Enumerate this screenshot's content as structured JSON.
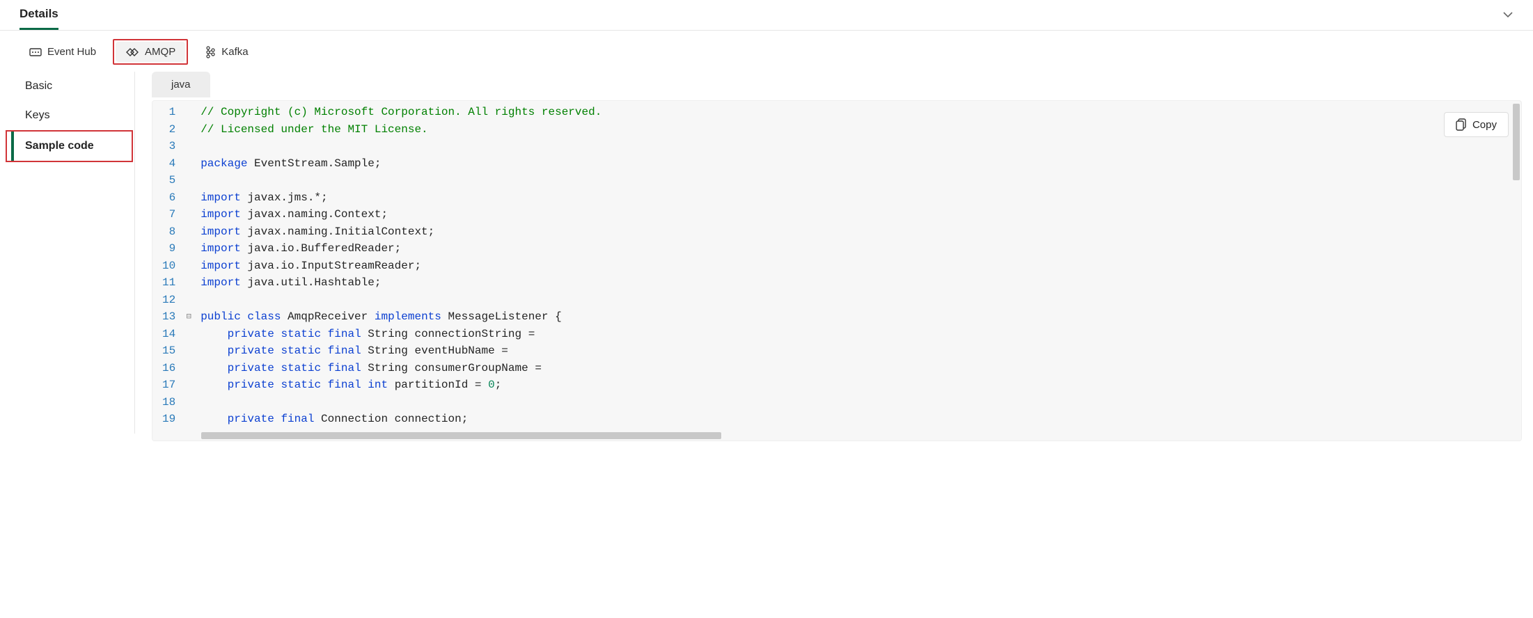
{
  "header": {
    "title": "Details"
  },
  "protoTabs": {
    "items": [
      {
        "label": "Event Hub"
      },
      {
        "label": "AMQP"
      },
      {
        "label": "Kafka"
      }
    ],
    "selectedIndex": 1
  },
  "sidebar": {
    "items": [
      {
        "label": "Basic"
      },
      {
        "label": "Keys"
      },
      {
        "label": "Sample code"
      }
    ],
    "activeIndex": 2
  },
  "langTab": {
    "label": "java"
  },
  "copy": {
    "label": "Copy"
  },
  "code": {
    "lines": [
      [
        {
          "cls": "tok-comment",
          "t": "// Copyright (c) Microsoft Corporation. All rights reserved."
        }
      ],
      [
        {
          "cls": "tok-comment",
          "t": "// Licensed under the MIT License."
        }
      ],
      [
        {
          "cls": "tok-plain",
          "t": ""
        }
      ],
      [
        {
          "cls": "tok-keyword",
          "t": "package"
        },
        {
          "cls": "tok-plain",
          "t": " EventStream.Sample;"
        }
      ],
      [
        {
          "cls": "tok-plain",
          "t": ""
        }
      ],
      [
        {
          "cls": "tok-keyword",
          "t": "import"
        },
        {
          "cls": "tok-plain",
          "t": " javax.jms.*;"
        }
      ],
      [
        {
          "cls": "tok-keyword",
          "t": "import"
        },
        {
          "cls": "tok-plain",
          "t": " javax.naming.Context;"
        }
      ],
      [
        {
          "cls": "tok-keyword",
          "t": "import"
        },
        {
          "cls": "tok-plain",
          "t": " javax.naming.InitialContext;"
        }
      ],
      [
        {
          "cls": "tok-keyword",
          "t": "import"
        },
        {
          "cls": "tok-plain",
          "t": " java.io.BufferedReader;"
        }
      ],
      [
        {
          "cls": "tok-keyword",
          "t": "import"
        },
        {
          "cls": "tok-plain",
          "t": " java.io.InputStreamReader;"
        }
      ],
      [
        {
          "cls": "tok-keyword",
          "t": "import"
        },
        {
          "cls": "tok-plain",
          "t": " java.util.Hashtable;"
        }
      ],
      [
        {
          "cls": "tok-plain",
          "t": ""
        }
      ],
      [
        {
          "cls": "tok-keyword",
          "t": "public"
        },
        {
          "cls": "tok-plain",
          "t": " "
        },
        {
          "cls": "tok-keyword",
          "t": "class"
        },
        {
          "cls": "tok-plain",
          "t": " AmqpReceiver "
        },
        {
          "cls": "tok-keyword",
          "t": "implements"
        },
        {
          "cls": "tok-plain",
          "t": " MessageListener {"
        }
      ],
      [
        {
          "cls": "tok-plain",
          "t": "    "
        },
        {
          "cls": "tok-keyword",
          "t": "private"
        },
        {
          "cls": "tok-plain",
          "t": " "
        },
        {
          "cls": "tok-keyword",
          "t": "static"
        },
        {
          "cls": "tok-plain",
          "t": " "
        },
        {
          "cls": "tok-keyword",
          "t": "final"
        },
        {
          "cls": "tok-plain",
          "t": " String connectionString = "
        }
      ],
      [
        {
          "cls": "tok-plain",
          "t": "    "
        },
        {
          "cls": "tok-keyword",
          "t": "private"
        },
        {
          "cls": "tok-plain",
          "t": " "
        },
        {
          "cls": "tok-keyword",
          "t": "static"
        },
        {
          "cls": "tok-plain",
          "t": " "
        },
        {
          "cls": "tok-keyword",
          "t": "final"
        },
        {
          "cls": "tok-plain",
          "t": " String eventHubName = "
        }
      ],
      [
        {
          "cls": "tok-plain",
          "t": "    "
        },
        {
          "cls": "tok-keyword",
          "t": "private"
        },
        {
          "cls": "tok-plain",
          "t": " "
        },
        {
          "cls": "tok-keyword",
          "t": "static"
        },
        {
          "cls": "tok-plain",
          "t": " "
        },
        {
          "cls": "tok-keyword",
          "t": "final"
        },
        {
          "cls": "tok-plain",
          "t": " String consumerGroupName = "
        }
      ],
      [
        {
          "cls": "tok-plain",
          "t": "    "
        },
        {
          "cls": "tok-keyword",
          "t": "private"
        },
        {
          "cls": "tok-plain",
          "t": " "
        },
        {
          "cls": "tok-keyword",
          "t": "static"
        },
        {
          "cls": "tok-plain",
          "t": " "
        },
        {
          "cls": "tok-keyword",
          "t": "final"
        },
        {
          "cls": "tok-plain",
          "t": " "
        },
        {
          "cls": "tok-keyword",
          "t": "int"
        },
        {
          "cls": "tok-plain",
          "t": " partitionId = "
        },
        {
          "cls": "tok-number",
          "t": "0"
        },
        {
          "cls": "tok-plain",
          "t": ";"
        }
      ],
      [
        {
          "cls": "tok-plain",
          "t": ""
        }
      ],
      [
        {
          "cls": "tok-plain",
          "t": "    "
        },
        {
          "cls": "tok-keyword",
          "t": "private"
        },
        {
          "cls": "tok-plain",
          "t": " "
        },
        {
          "cls": "tok-keyword",
          "t": "final"
        },
        {
          "cls": "tok-plain",
          "t": " Connection connection;"
        }
      ]
    ],
    "foldAt": 13
  }
}
